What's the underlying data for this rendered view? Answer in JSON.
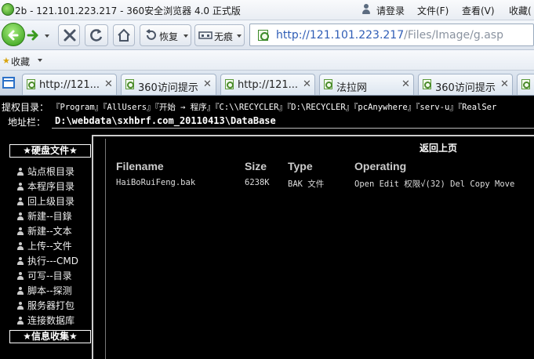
{
  "window": {
    "title": "2b - 121.101.223.217 - 360安全浏览器 4.0 正式版",
    "login": "请登录",
    "menus": [
      "文件(F)",
      "查看(V)",
      "收藏("
    ]
  },
  "toolbar": {
    "restore_label": "恢复",
    "incognito_label": "无痕",
    "url_host": "http://121.101.223.217",
    "url_path": "/Files/Image/g.asp"
  },
  "favorites": {
    "label": "收藏"
  },
  "tabs": [
    {
      "label": "http://121..."
    },
    {
      "label": "360访问提示"
    },
    {
      "label": "http://121..."
    },
    {
      "label": "法拉网"
    },
    {
      "label": "360访问提示"
    }
  ],
  "page": {
    "privilege_label": "提权目录：",
    "privilege_paths": "『Program』『AllUsers』『开始 → 程序』『C:\\\\RECYCLER』『D:\\RECYCLER』『pcAnywhere』『serv-u』『RealSer",
    "address_label": "地址栏：",
    "address_value": "D:\\webdata\\sxhbrf.com_20110413\\DataBase",
    "left_nav": {
      "section1": "★硬盘文件★",
      "items": [
        "站点根目录",
        "本程序目录",
        "回上级目录",
        "新建--目錄",
        "新建--文本",
        "上传--文件",
        "执行---CMD",
        "可写--目录",
        "脚本--探测",
        "服务器打包",
        "连接数据库"
      ],
      "section2": "★信息收集★"
    },
    "back_link": "返回上页",
    "table": {
      "headers": [
        "Filename",
        "Size",
        "Type",
        "Operating"
      ],
      "rows": [
        {
          "filename": "HaiBoRuiFeng.bak",
          "size": "6238K",
          "type": "BAK 文件",
          "operating": "Open Edit 权限√(32) Del Copy Move"
        }
      ]
    }
  }
}
